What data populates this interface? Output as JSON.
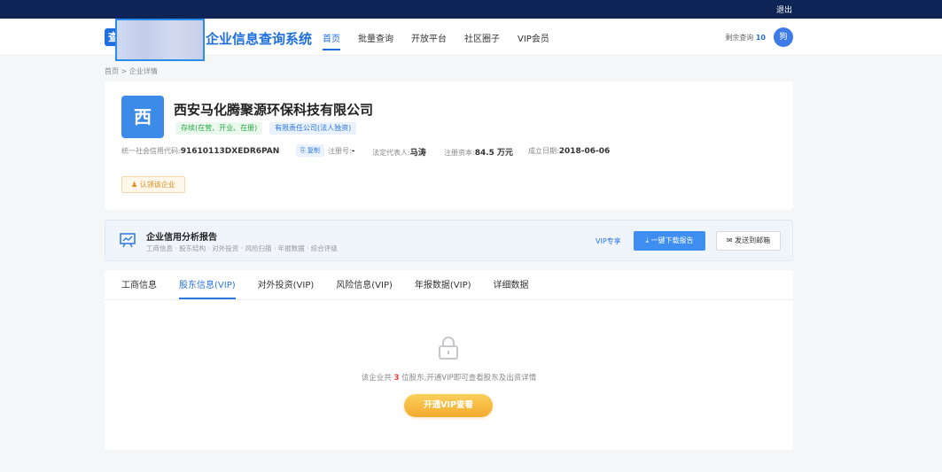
{
  "topbar": {
    "logout": "退出"
  },
  "header": {
    "site_title": "企业信息查询系统",
    "nav": [
      "首页",
      "批量查询",
      "开放平台",
      "社区圈子",
      "VIP会员"
    ],
    "quota_label": "剩余查询",
    "quota_value": "10",
    "avatar_text": "狗"
  },
  "breadcrumb": "首页 > 企业详情",
  "company": {
    "icon_char": "西",
    "name": "西安马化腾聚源环保科技有限公司",
    "status_tag": "存续(在营、开业、在册)",
    "type_tag": "有限责任公司(法人独资)",
    "credit_code_label": "统一社会信用代码:",
    "credit_code": "91610113DXEDR6PAN",
    "copy_label": "复制",
    "reg_no_label": "注册号:",
    "reg_no": "-",
    "legal_rep_label": "法定代表人:",
    "legal_rep": "马涛",
    "capital_label": "注册资本:",
    "capital": "84.5 万元",
    "founded_label": "成立日期:",
    "founded": "2018-06-06",
    "claim_button": "认领该企业"
  },
  "report": {
    "title": "企业信用分析报告",
    "subtitle": "工商信息 · 股东结构 · 对外投资 · 风险扫描 · 年报数据 · 综合评级",
    "vip_only": "VIP专享",
    "download_button": "一键下载报告",
    "mail_button": "发送到邮箱"
  },
  "tabs": [
    "工商信息",
    "股东信息(VIP)",
    "对外投资(VIP)",
    "风险信息(VIP)",
    "年报数据(VIP)",
    "详细数据"
  ],
  "locked": {
    "text_before": "该企业共",
    "count": "3",
    "text_after": "位股东,开通VIP即可查看股东及出资详情",
    "open_button": "开通VIP查看"
  },
  "colors": {
    "brand": "#1f6fe0",
    "topbar": "#0e2356",
    "accent_gold": "#f2a92e"
  }
}
